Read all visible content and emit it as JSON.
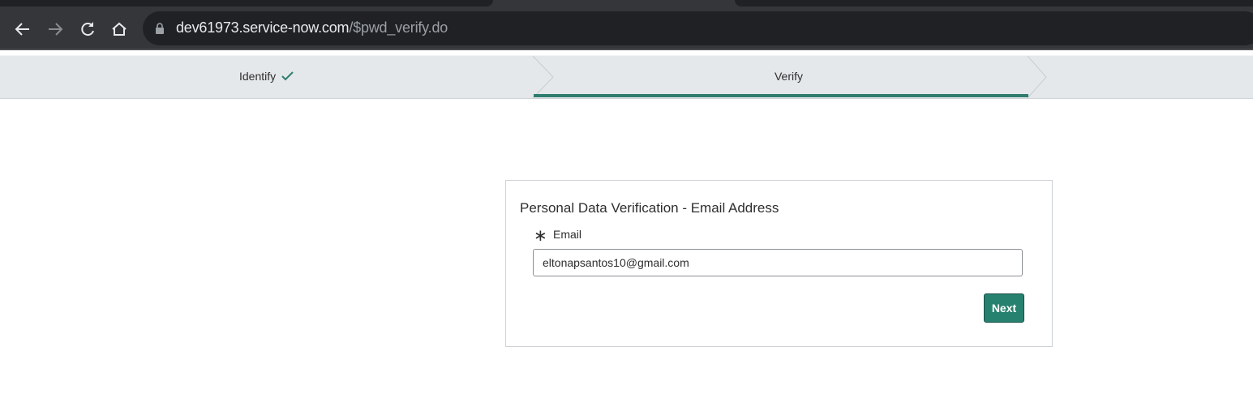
{
  "browser": {
    "url_host": "dev61973.service-now.com",
    "url_path": "/$pwd_verify.do",
    "icons": [
      "back-icon",
      "forward-icon",
      "reload-icon",
      "home-icon",
      "lock-icon"
    ]
  },
  "steps": [
    {
      "label": "Identify",
      "completed": true
    },
    {
      "label": "Verify",
      "active": true
    }
  ],
  "form": {
    "title": "Personal Data Verification - Email Address",
    "required_marker": "∗",
    "email_label": "Email",
    "email_value": "eltonapsantos10@gmail.com",
    "next_label": "Next"
  },
  "colors": {
    "accent": "#26826f"
  }
}
